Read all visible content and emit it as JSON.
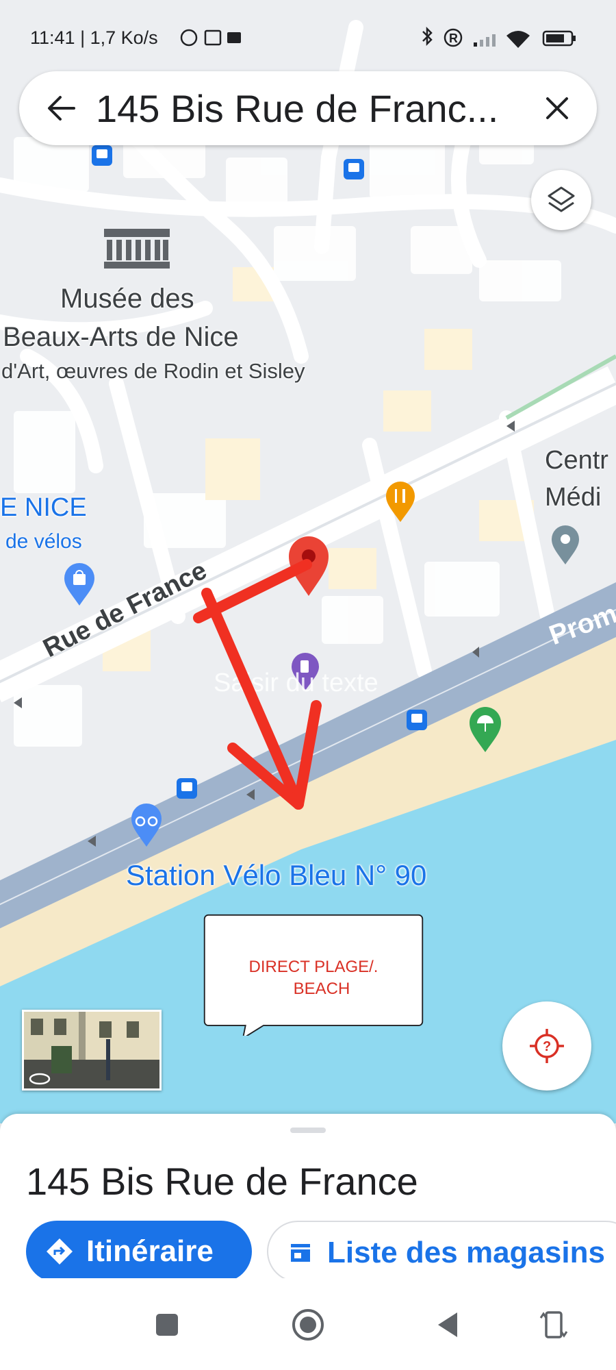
{
  "status_bar": {
    "time_speed": "11:41 | 1,7 Ko/s",
    "right_icons": [
      "bluetooth-icon",
      "registered-icon",
      "signal-icon",
      "wifi-icon",
      "battery-icon"
    ]
  },
  "search": {
    "query": "145 Bis Rue de Franc...",
    "back_icon": "arrow-left-icon",
    "clear_icon": "close-icon"
  },
  "map": {
    "labels": {
      "museum_line1": "Musée des",
      "museum_line2": "Beaux-Arts de Nice",
      "museum_sub": "d'Art, œuvres de Rodin et Sisley",
      "nice_label": "E NICE",
      "bike_label": "de vélos",
      "centre_line1": "Centr",
      "centre_line2": "Médi",
      "street": "Rue de France",
      "promenade": "Prom",
      "station": "Station Vélo Bleu N° 90",
      "watermark": "Saisir du texte"
    },
    "callout": {
      "line1": "DIRECT PLAGE/.",
      "line2": "BEACH"
    },
    "colors": {
      "water": "#8fd9f0",
      "beach": "#f6e9c8",
      "promenade_road": "#9fb3cc",
      "pin": "#ea4335",
      "arrow": "#f03022"
    }
  },
  "sheet": {
    "title": "145 Bis Rue de France",
    "directions_label": "Itinéraire",
    "stores_label": "Liste des magasins"
  },
  "navbar": {
    "icons": [
      "recents-square-icon",
      "home-circle-icon",
      "back-triangle-icon",
      "rotate-icon"
    ]
  }
}
